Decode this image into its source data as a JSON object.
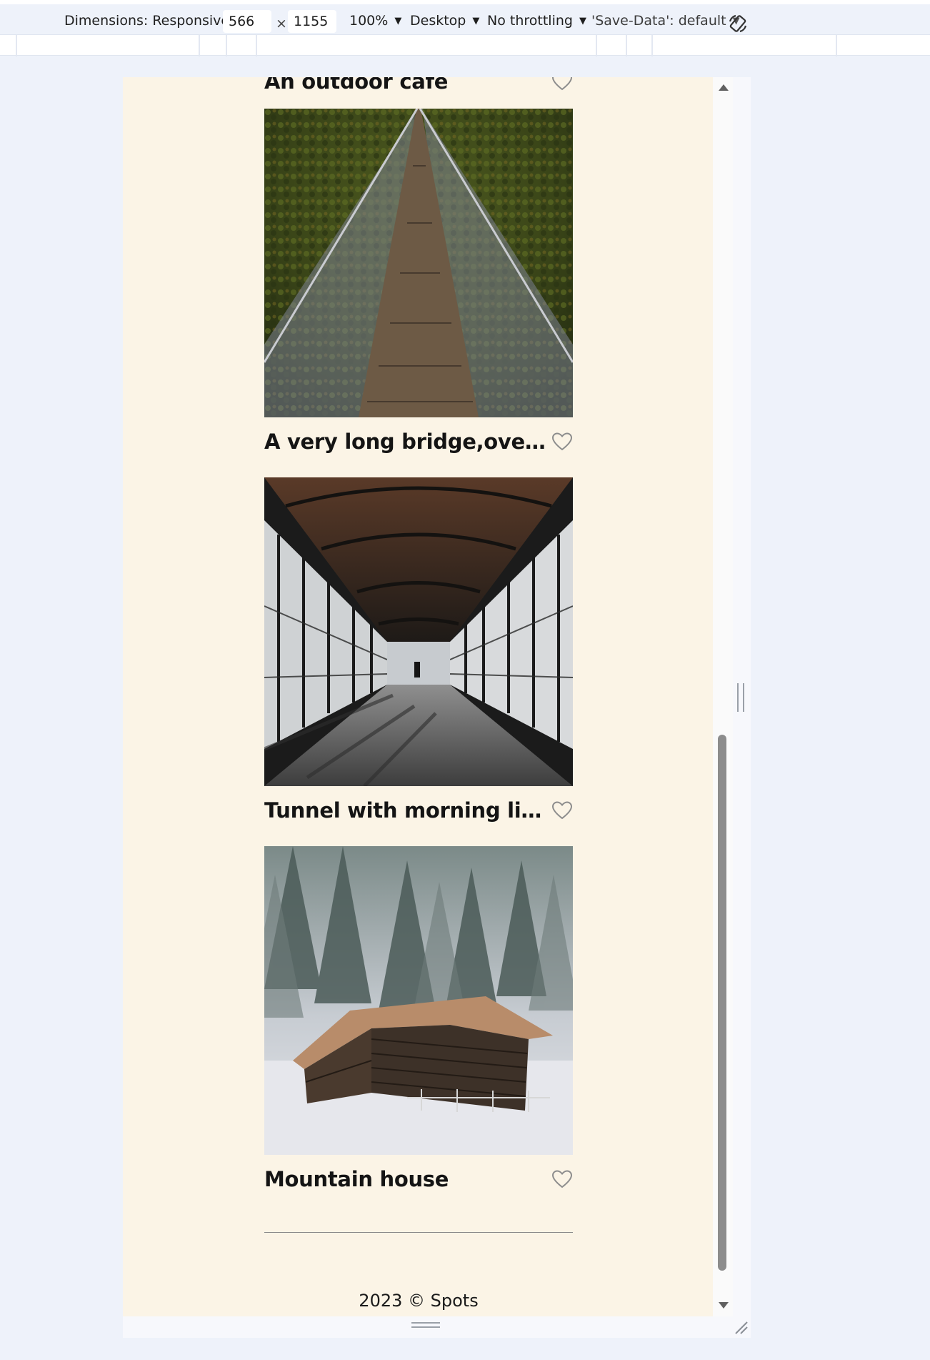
{
  "devtools": {
    "dimensions_label": "Dimensions: Responsive",
    "width_value": "566",
    "times_sign": "×",
    "height_value": "1155",
    "zoom": "100%",
    "device_type": "Desktop",
    "throttling": "No throttling",
    "save_data": "'Save-Data': default"
  },
  "cards": [
    {
      "title": "An outdoor cafe"
    },
    {
      "title": "A very long bridge,over th..."
    },
    {
      "title": "Tunnel with morning light"
    },
    {
      "title": "Mountain house"
    }
  ],
  "footer": {
    "text": "2023 © Spots"
  },
  "colors": {
    "page_bg": "#fbf4e6",
    "chrome_bg": "#eef2fa",
    "heart_stroke": "#8d8d8d"
  }
}
